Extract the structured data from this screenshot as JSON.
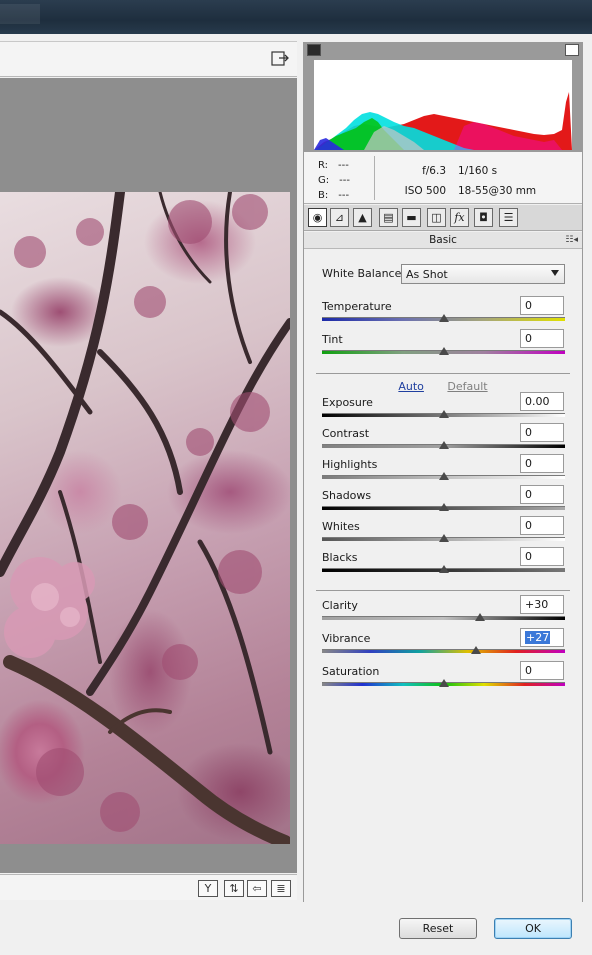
{
  "preview": {
    "fullscreen_icon": "fullscreen-toggle-icon",
    "bottom_icons": [
      "y-icon",
      "sync-icon",
      "back-icon",
      "settings-icon"
    ],
    "bottom_glyphs": [
      "Y",
      "⇅",
      "⇦",
      "≣"
    ]
  },
  "histogram": {
    "shadow_clip_icon": "shadow-clipping-warning-icon",
    "highlight_clip_icon": "highlight-clipping-warning-icon"
  },
  "info": {
    "r_label": "R:",
    "r_value": "---",
    "g_label": "G:",
    "g_value": "---",
    "b_label": "B:",
    "b_value": "---",
    "aperture": "f/6.3",
    "shutter": "1/160 s",
    "iso": "ISO 500",
    "lens": "18-55@30 mm"
  },
  "tabs": [
    {
      "icon": "basic-icon",
      "glyph": "◉"
    },
    {
      "icon": "tone-curve-icon",
      "glyph": "⊿"
    },
    {
      "icon": "detail-icon",
      "glyph": "▲"
    },
    {
      "icon": "hsl-icon",
      "glyph": "▤"
    },
    {
      "icon": "split-toning-icon",
      "glyph": "▬"
    },
    {
      "icon": "lens-corrections-icon",
      "glyph": "◫"
    },
    {
      "icon": "effects-icon",
      "glyph": "fx"
    },
    {
      "icon": "camera-calibration-icon",
      "glyph": "◘"
    },
    {
      "icon": "presets-icon",
      "glyph": "☰"
    }
  ],
  "panel": {
    "title": "Basic",
    "menu_glyph": "☷◂",
    "white_balance_label": "White Balance:",
    "white_balance_value": "As Shot",
    "auto_label": "Auto",
    "default_label": "Default"
  },
  "sliders": {
    "temperature": {
      "label": "Temperature",
      "value": "0"
    },
    "tint": {
      "label": "Tint",
      "value": "0"
    },
    "exposure": {
      "label": "Exposure",
      "value": "0.00"
    },
    "contrast": {
      "label": "Contrast",
      "value": "0"
    },
    "highlights": {
      "label": "Highlights",
      "value": "0"
    },
    "shadows": {
      "label": "Shadows",
      "value": "0"
    },
    "whites": {
      "label": "Whites",
      "value": "0"
    },
    "blacks": {
      "label": "Blacks",
      "value": "0"
    },
    "clarity": {
      "label": "Clarity",
      "value": "+30"
    },
    "vibrance": {
      "label": "Vibrance",
      "value": "+27"
    },
    "saturation": {
      "label": "Saturation",
      "value": "0"
    }
  },
  "slider_levels": {
    "temperature": 0.5,
    "tint": 0.5,
    "exposure": 0.5,
    "contrast": 0.5,
    "highlights": 0.5,
    "shadows": 0.5,
    "whites": 0.5,
    "blacks": 0.5,
    "clarity": 0.65,
    "vibrance": 0.635,
    "saturation": 0.5
  },
  "buttons": {
    "reset": "Reset",
    "ok": "OK"
  },
  "colors": {
    "ok_border": "#3c7fb1",
    "auto_link": "#1f3f9f",
    "selection": "#3b78d8"
  }
}
